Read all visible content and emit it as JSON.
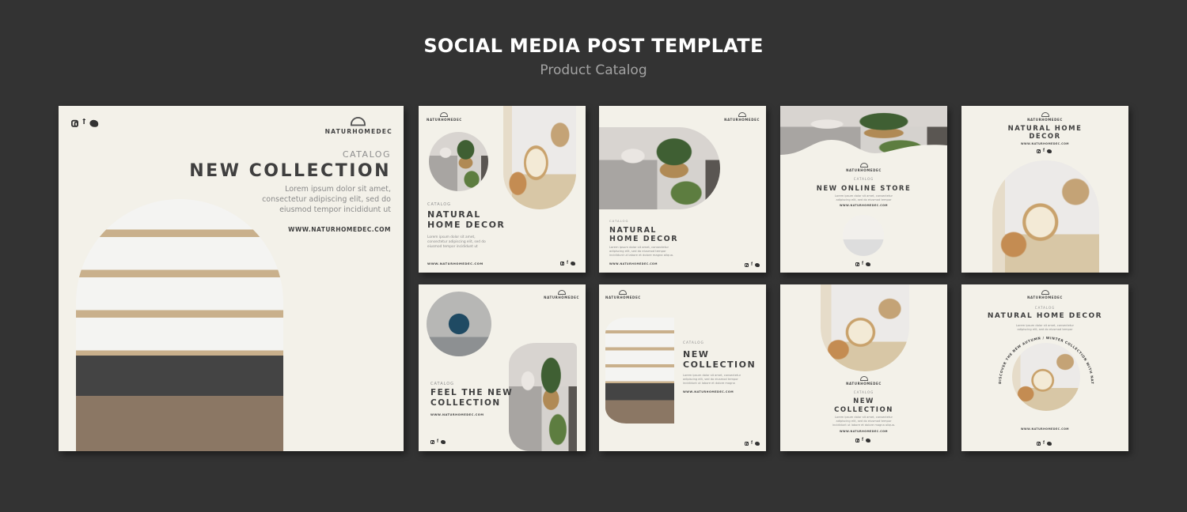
{
  "header": {
    "title": "SOCIAL MEDIA POST TEMPLATE",
    "subtitle": "Product Catalog"
  },
  "brand": "NATURHOMEDEC",
  "url": "WWW.NATURHOMEDEC.COM",
  "catalog": "CATALOG",
  "social_icons": [
    "instagram-icon",
    "facebook-icon",
    "twitter-icon"
  ],
  "colors": {
    "background": "#333333",
    "card": "#f3f1e9",
    "heading": "#3f3f3f",
    "muted": "#8f8f8f"
  },
  "posts": [
    {
      "title": "NEW COLLECTION",
      "body": "Lorem ipsum dolor sit amet, consectetur adipiscing elit, sed do eiusmod tempor incididunt ut"
    },
    {
      "title_lines": [
        "NATURAL",
        "HOME DECOR"
      ],
      "body": "Lorem ipsum dolor sit amet, consectetur adipiscing elit, sed do eiusmod tempor incididunt ut"
    },
    {
      "title_lines": [
        "NATURAL",
        "HOME DECOR"
      ],
      "body": "Lorem ipsum dolor sit amet, consectetur adipiscing elit, sed do eiusmod tempor incididunt ut labore et dolore magna aliqua."
    },
    {
      "title": "NEW ONLINE STORE",
      "body": "Lorem ipsum dolor sit amet, consectetur adipiscing elit, sed do eiusmod tempor"
    },
    {
      "title_lines": [
        "NATURAL HOME",
        "DECOR"
      ]
    },
    {
      "title_lines": [
        "FEEL THE NEW",
        "COLLECTION"
      ]
    },
    {
      "title_lines": [
        "NEW",
        "COLLECTION"
      ],
      "body": "Lorem ipsum dolor sit amet, consectetur adipiscing elit, sed do eiusmod tempor incididunt ut labore et dolore magna"
    },
    {
      "title_lines": [
        "NEW",
        "COLLECTION"
      ],
      "body": "Lorem ipsum dolor sit amet, consectetur adipiscing elit, sed do eiusmod tempor incididunt ut labore et dolore magna aliqua."
    },
    {
      "title": "NATURAL HOME DECOR",
      "body": "Lorem ipsum dolor sit amet, consectetur adipiscing elit, sed do eiusmod tempor",
      "ring_text": "DISCOVER THE NEW AUTUMN / WINTER COLLECTION WITH NATURAL AND RECYCLED MATERIALS"
    }
  ]
}
